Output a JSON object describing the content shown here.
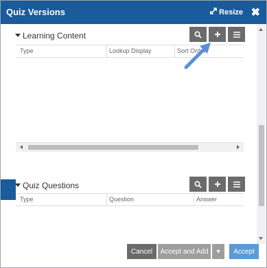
{
  "dialog": {
    "title": "Quiz Versions",
    "resize_label": "Resize",
    "close_glyph": "✖"
  },
  "sections": [
    {
      "title": "Learning Content",
      "columns": [
        "Type",
        "Lookup Display",
        "Sort Order"
      ]
    },
    {
      "title": "Quiz Questions",
      "columns": [
        "Type",
        "Question",
        "Answer"
      ]
    }
  ],
  "icons": {
    "search": "search-icon",
    "add": "plus-icon",
    "menu": "hamburger-menu-icon"
  },
  "footer": {
    "cancel_label": "Cancel",
    "accept_add_label": "Accept and Add",
    "dropdown_glyph": "▾",
    "accept_label": "Accept"
  },
  "colors": {
    "titlebar": "#1a5b9b",
    "icon_button": "#6b6b6b",
    "accept_button": "#5b9bd5",
    "annotation_arrow": "#5b8fd8"
  }
}
